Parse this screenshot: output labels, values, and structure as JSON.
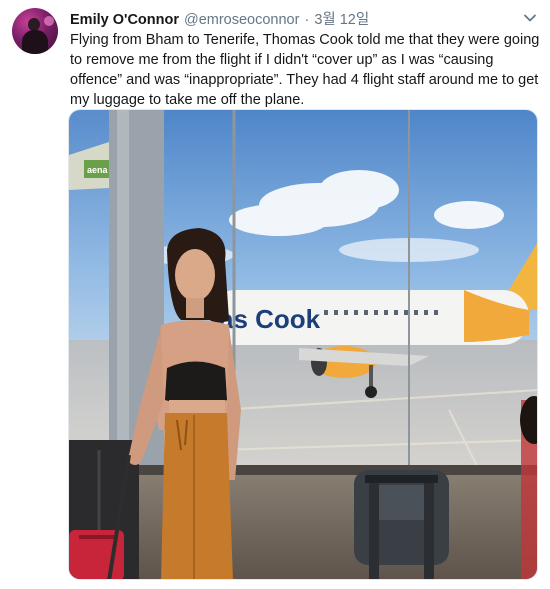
{
  "tweet": {
    "display_name": "Emily O'Connor",
    "handle": "@emroseoconnor",
    "separator": "·",
    "date": "3월 12일",
    "text": "Flying from Bham to Tenerife, Thomas Cook told me that they were going to remove me from the flight if I didn't “cover up” as I was “causing offence” and was “inappropriate”. They had 4 flight staff around me to get my luggage to take me off the plane."
  },
  "media": {
    "airline_livery": "as Cook",
    "signage": "aena"
  },
  "icons": {
    "menu": "chevron-down-icon",
    "avatar": "avatar-icon"
  },
  "colors": {
    "text": "#14171a",
    "secondary": "#657786",
    "border": "#e1e8ed"
  }
}
